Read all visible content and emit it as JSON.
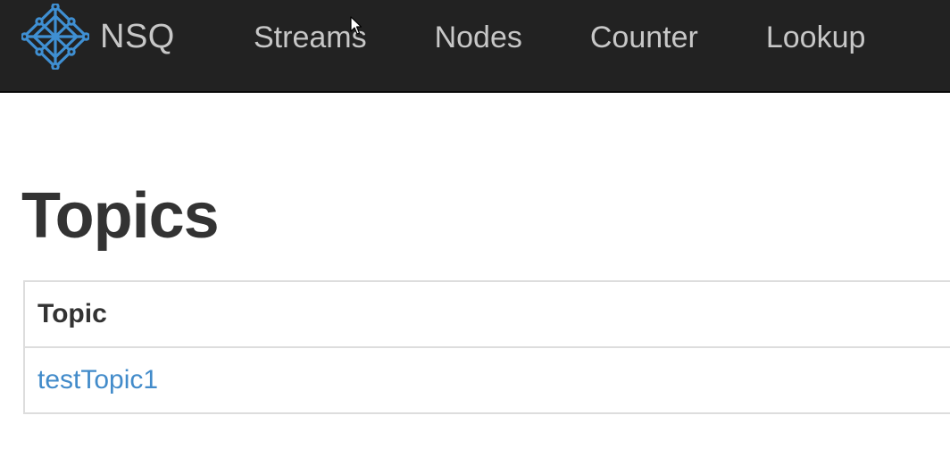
{
  "navbar": {
    "brand": "NSQ",
    "links": [
      {
        "label": "Streams"
      },
      {
        "label": "Nodes"
      },
      {
        "label": "Counter"
      },
      {
        "label": "Lookup"
      }
    ]
  },
  "main": {
    "title": "Topics",
    "table": {
      "columns": [
        "Topic"
      ],
      "rows": [
        {
          "topic": "testTopic1"
        }
      ]
    }
  },
  "colors": {
    "navbar_bg": "#222222",
    "nav_text": "#c7c7c7",
    "logo_accent": "#3f8fd2",
    "link": "#428bca",
    "heading": "#333333",
    "table_border": "#dddddd"
  },
  "icons": {
    "logo": "nsq-network-logo-icon",
    "pointer": "mouse-pointer-icon"
  }
}
